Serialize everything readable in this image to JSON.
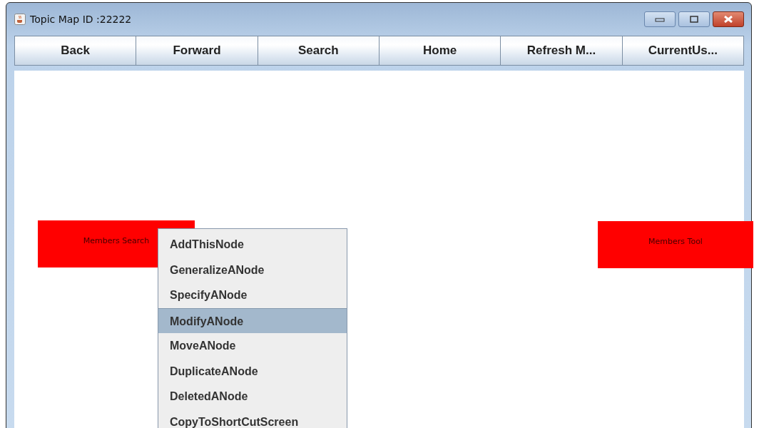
{
  "window": {
    "title": "Topic Map ID :22222"
  },
  "toolbar": [
    {
      "label": "Back"
    },
    {
      "label": "Forward"
    },
    {
      "label": "Search"
    },
    {
      "label": "Home"
    },
    {
      "label": "Refresh M..."
    },
    {
      "label": "CurrentUs..."
    }
  ],
  "nodes": [
    {
      "label": "Members Search",
      "color": "#ff0000"
    },
    {
      "label": "Members Tool",
      "color": "#ff0000"
    }
  ],
  "context_menu": [
    {
      "label": "AddThisNode",
      "selected": false
    },
    {
      "label": "GeneralizeANode",
      "selected": false
    },
    {
      "label": "SpecifyANode",
      "selected": false
    },
    {
      "label": "ModifyANode",
      "selected": true
    },
    {
      "label": "MoveANode",
      "selected": false
    },
    {
      "label": "DuplicateANode",
      "selected": false
    },
    {
      "label": "DeletedANode",
      "selected": false
    },
    {
      "label": "CopyToShortCutScreen",
      "selected": false
    }
  ]
}
